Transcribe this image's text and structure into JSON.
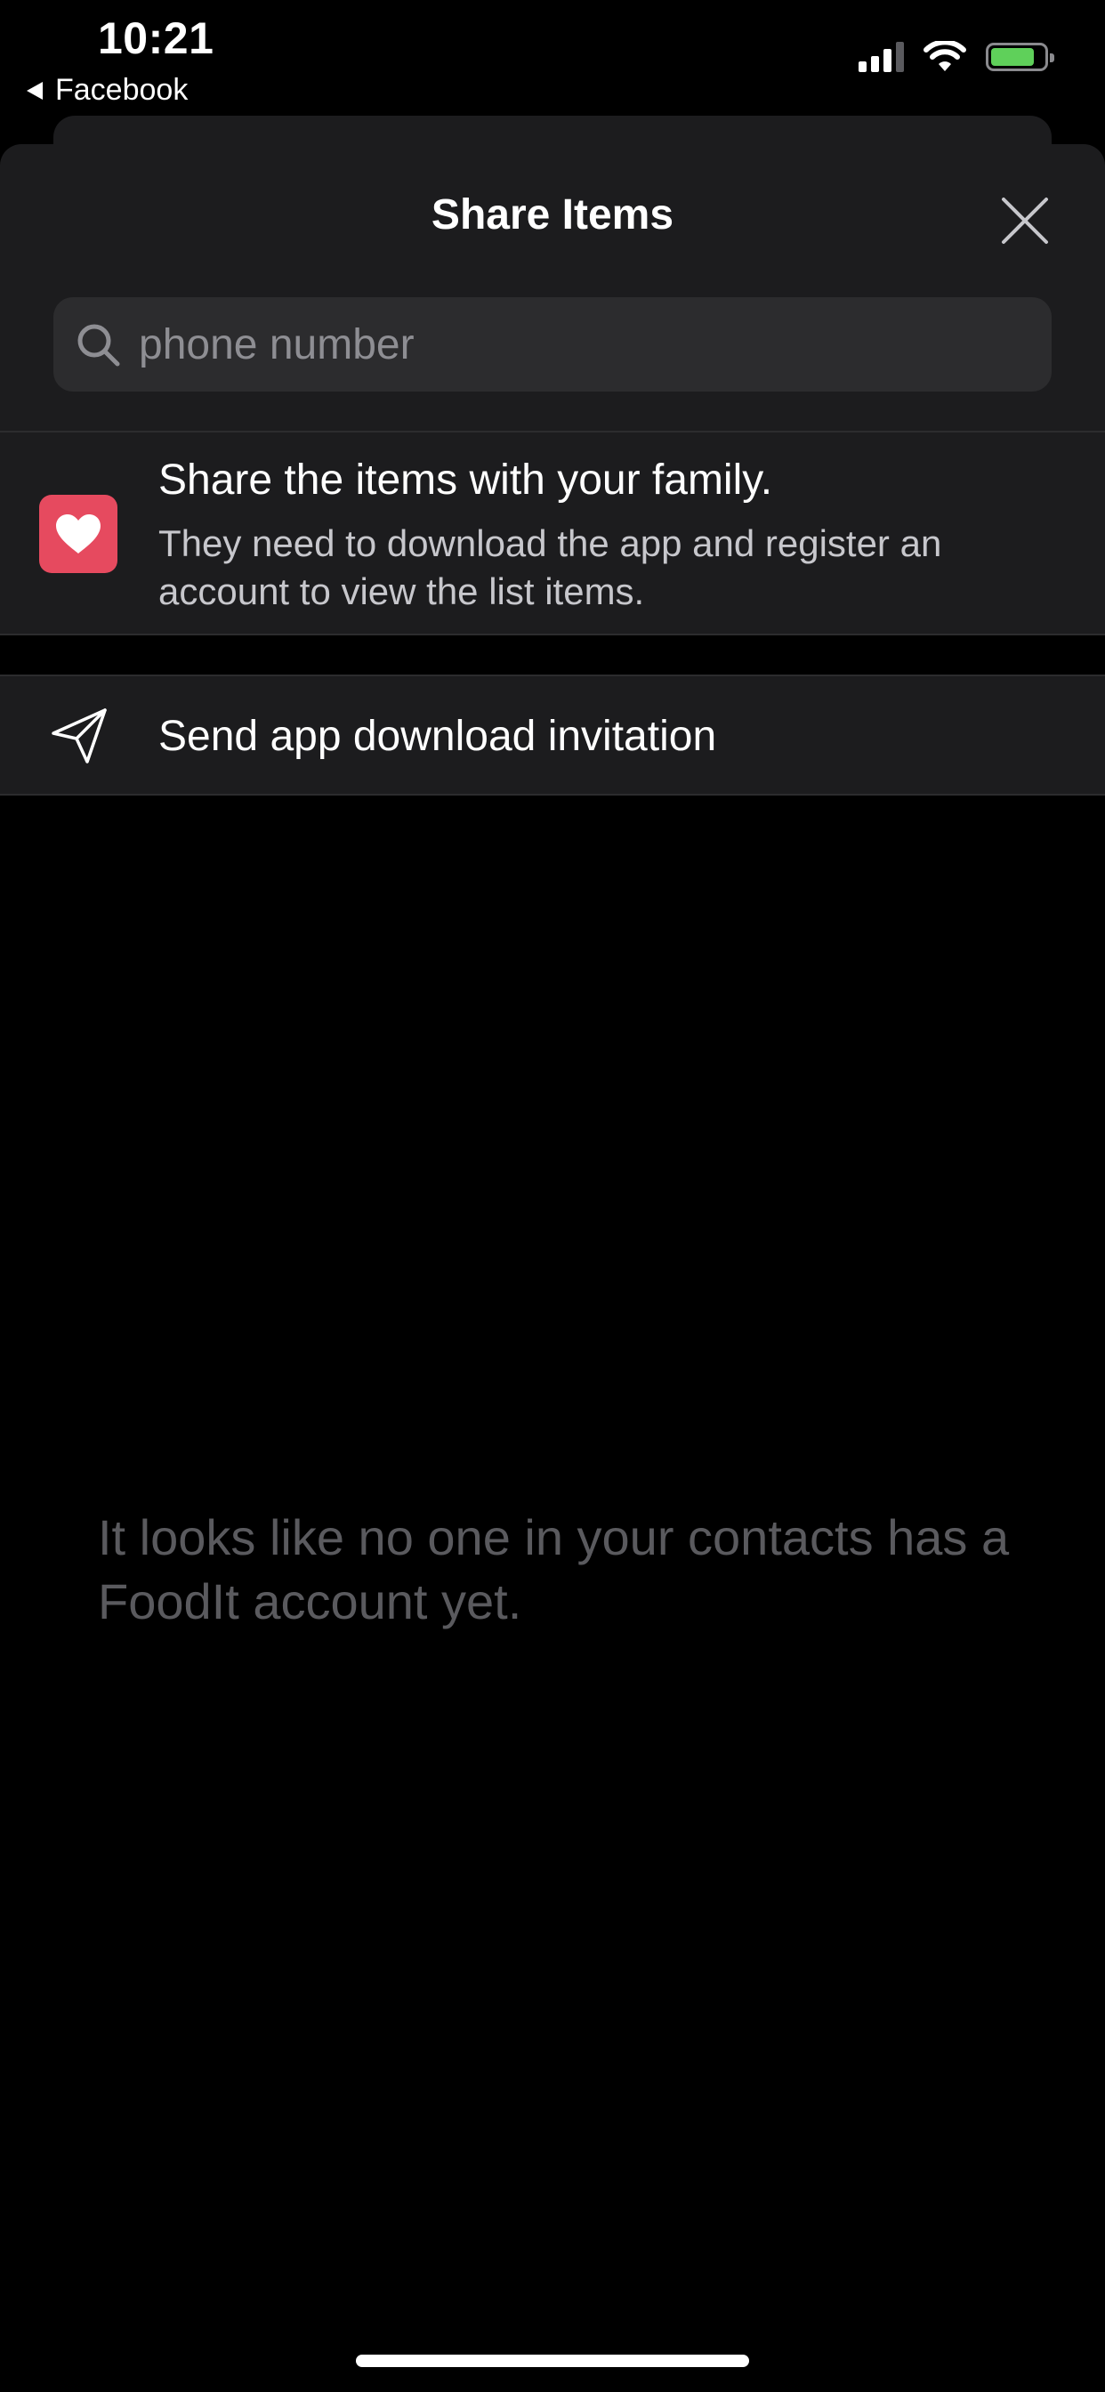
{
  "status_bar": {
    "time": "10:21",
    "back_label": "Facebook",
    "icons": [
      "cellular-signal-icon",
      "wifi-icon",
      "battery-icon"
    ],
    "battery_color": "#5fd05a"
  },
  "sheet": {
    "title": "Share Items",
    "close_icon": "close-icon",
    "search": {
      "placeholder": "phone number",
      "value": ""
    },
    "info": {
      "icon": "heart-icon",
      "icon_color": "#e64a5f",
      "title": "Share the items with your family.",
      "description": "They need to download the app and register an account to view the list items."
    },
    "invite": {
      "icon": "paper-plane-icon",
      "label": "Send app download invitation"
    },
    "empty_message": "It looks like no one in your contacts has a FoodIt account yet."
  }
}
